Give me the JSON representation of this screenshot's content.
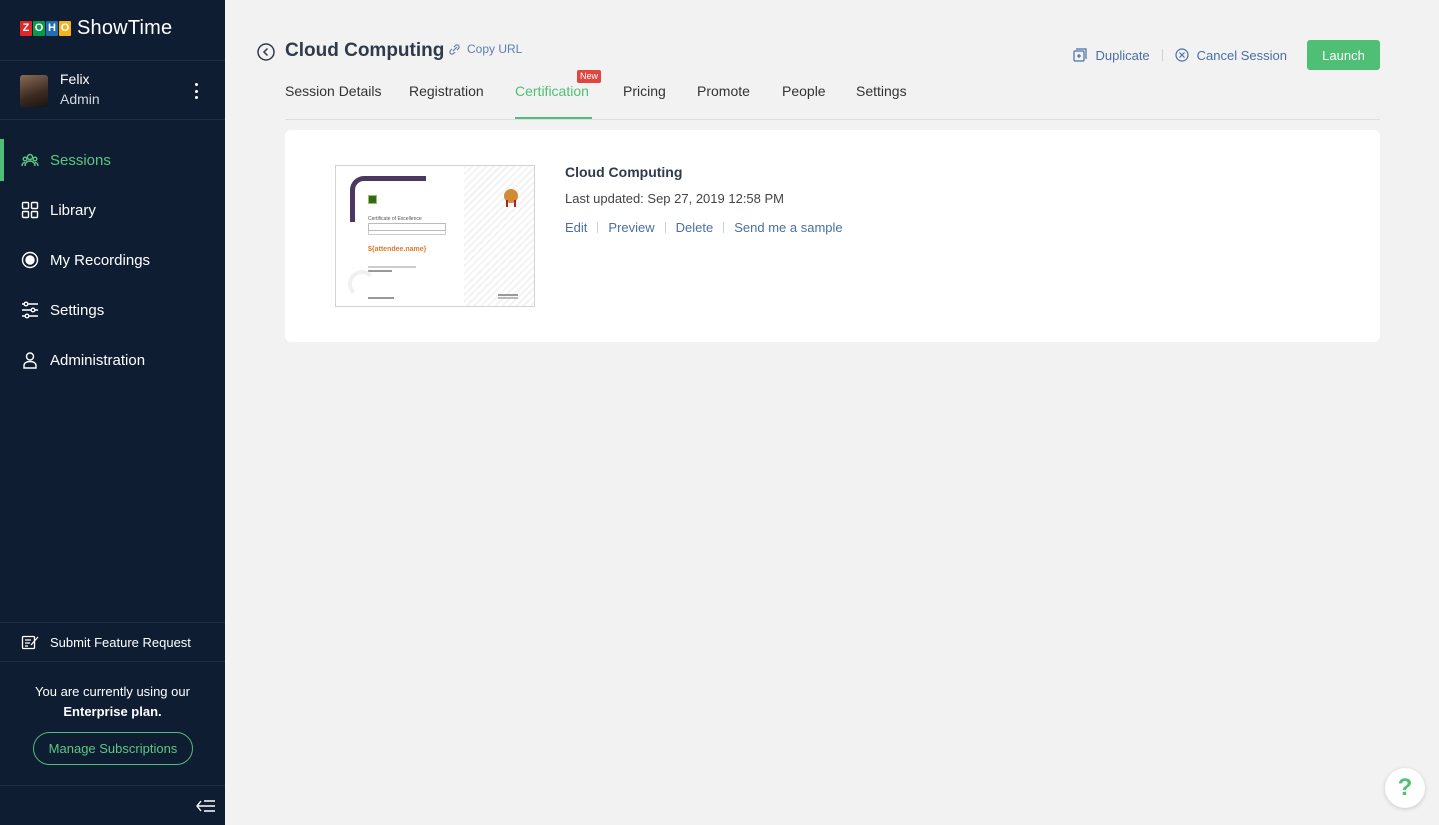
{
  "brand": {
    "logo_letters": [
      "Z",
      "O",
      "H",
      "O"
    ],
    "logo_colors": [
      "#e42527",
      "#089949",
      "#226db4",
      "#f9b21d"
    ],
    "name": "ShowTime"
  },
  "user": {
    "name": "Felix",
    "role": "Admin"
  },
  "sidebar": {
    "items": [
      {
        "label": "Sessions",
        "icon": "sessions-icon",
        "active": true
      },
      {
        "label": "Library",
        "icon": "grid-icon"
      },
      {
        "label": "My Recordings",
        "icon": "record-icon"
      },
      {
        "label": "Settings",
        "icon": "sliders-icon"
      },
      {
        "label": "Administration",
        "icon": "user-icon"
      }
    ],
    "feature_request": "Submit Feature Request",
    "plan_line1": "You are currently using our",
    "plan_line2": "Enterprise plan.",
    "manage_subscriptions": "Manage Subscriptions"
  },
  "header": {
    "title": "Cloud Computing",
    "copy_url": "Copy URL",
    "duplicate": "Duplicate",
    "cancel_session": "Cancel Session",
    "launch": "Launch"
  },
  "tabs": [
    {
      "label": "Session Details"
    },
    {
      "label": "Registration"
    },
    {
      "label": "Certification",
      "active": true,
      "badge": "New"
    },
    {
      "label": "Pricing"
    },
    {
      "label": "Promote"
    },
    {
      "label": "People"
    },
    {
      "label": "Settings"
    }
  ],
  "certificate": {
    "title": "Cloud Computing",
    "last_updated": "Last updated: Sep 27, 2019 12:58 PM",
    "thumb_title": "Certificate of Excellence",
    "thumb_placeholder": "${attendee.name}",
    "links": {
      "edit": "Edit",
      "preview": "Preview",
      "delete": "Delete",
      "send_sample": "Send me a sample"
    }
  },
  "help": "?",
  "colors": {
    "sidebar_bg": "#0f1d33",
    "accent": "#4fbf75",
    "link": "#4a6fa5",
    "badge": "#e0453e"
  }
}
